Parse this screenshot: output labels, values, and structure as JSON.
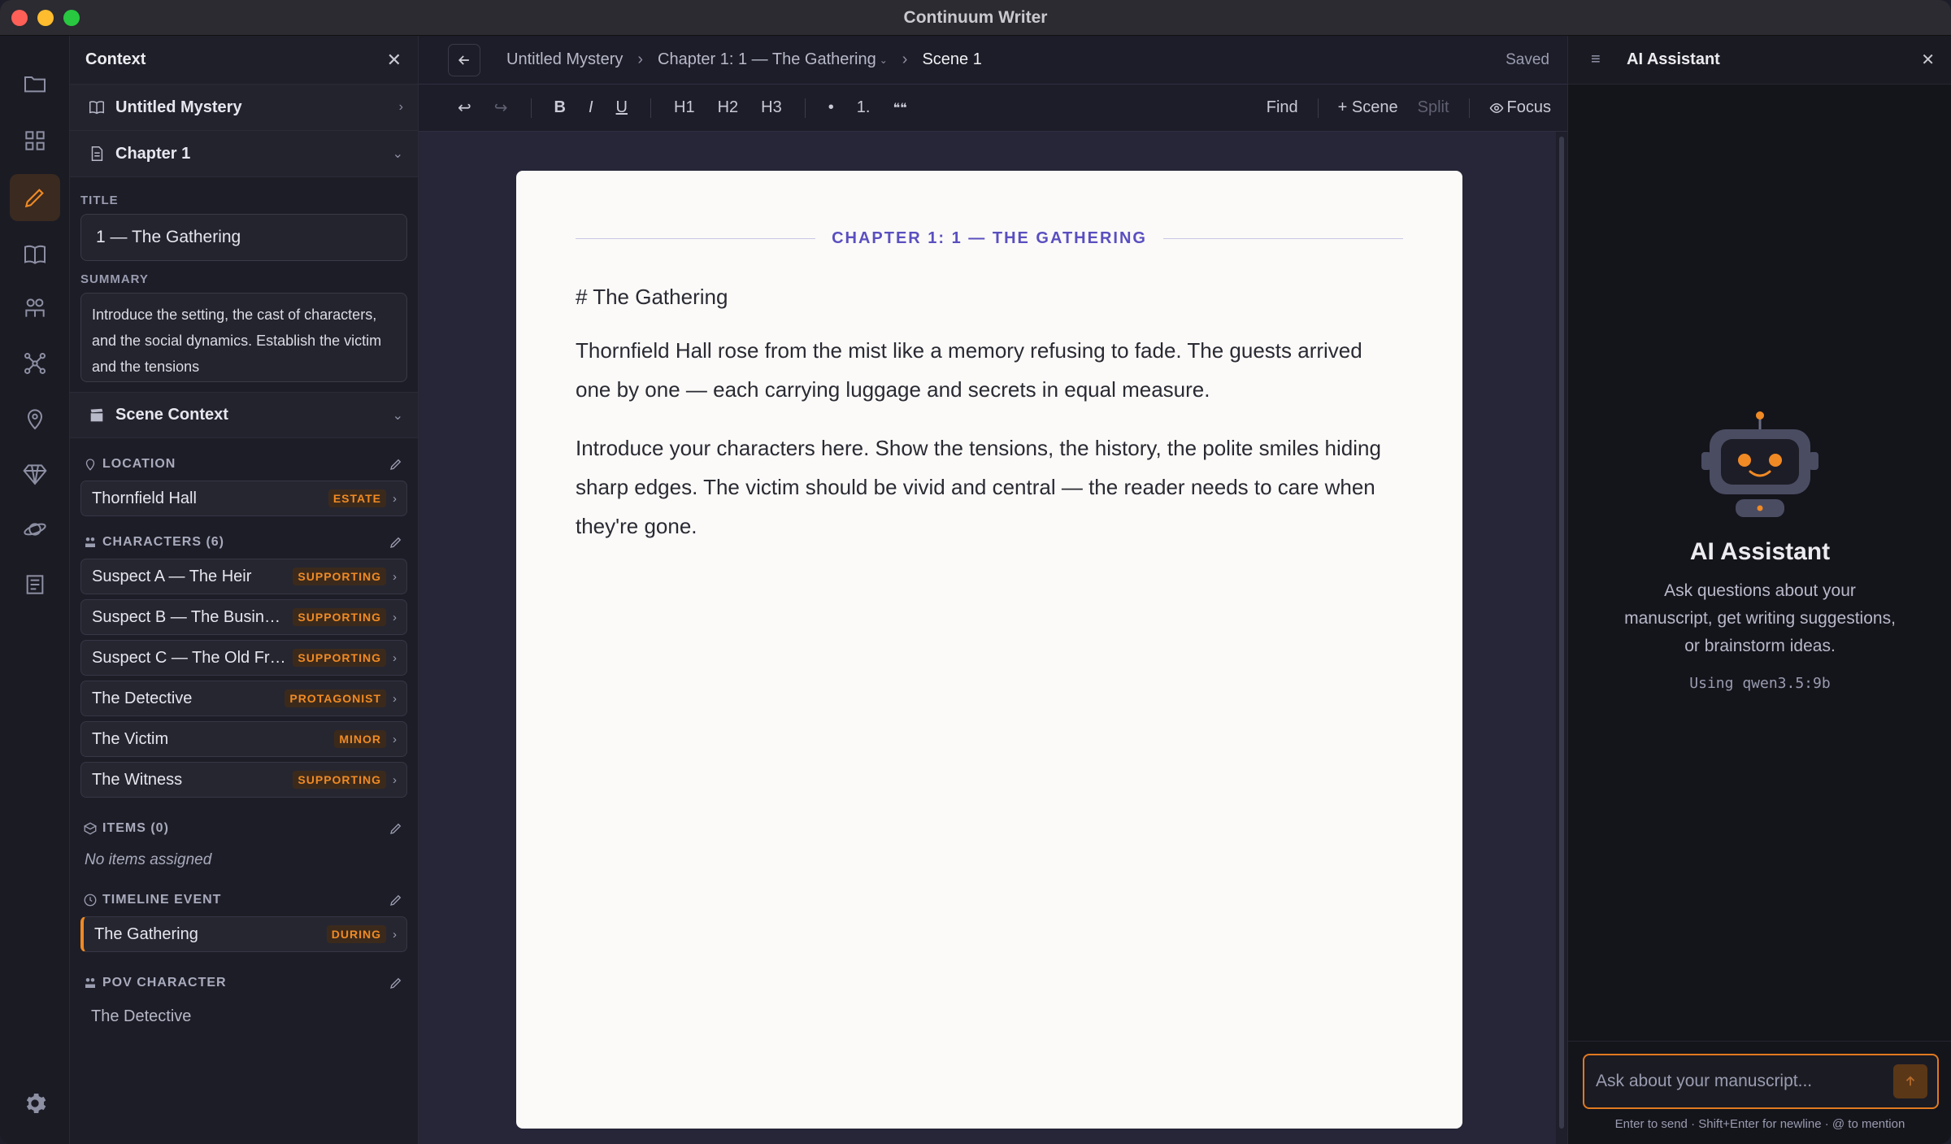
{
  "window": {
    "title": "Continuum Writer"
  },
  "rail": {
    "items": [
      {
        "icon": "folder-icon"
      },
      {
        "icon": "grid-icon"
      },
      {
        "icon": "pencil-icon",
        "active": true
      },
      {
        "icon": "book-icon"
      },
      {
        "icon": "characters-icon"
      },
      {
        "icon": "graph-icon"
      },
      {
        "icon": "location-pin-icon"
      },
      {
        "icon": "gem-icon"
      },
      {
        "icon": "planet-icon"
      },
      {
        "icon": "notes-icon"
      }
    ],
    "settings_icon": "gear-icon"
  },
  "context": {
    "header": "Context",
    "project": "Untitled Mystery",
    "chapter": "Chapter 1",
    "title_label": "TITLE",
    "title_value": "1 — The Gathering",
    "summary_label": "SUMMARY",
    "summary_value": "Introduce the setting, the cast of characters, and the social dynamics. Establish the victim and the tensions",
    "scene_context": "Scene Context",
    "location_label": "LOCATION",
    "location": {
      "name": "Thornfield Hall",
      "badge": "ESTATE"
    },
    "characters_label": "CHARACTERS (6)",
    "characters": [
      {
        "name": "Suspect A — The Heir",
        "badge": "SUPPORTING"
      },
      {
        "name": "Suspect B — The Businessman",
        "badge": "SUPPORTING"
      },
      {
        "name": "Suspect C — The Old Friend",
        "badge": "SUPPORTING"
      },
      {
        "name": "The Detective",
        "badge": "PROTAGONIST"
      },
      {
        "name": "The Victim",
        "badge": "MINOR"
      },
      {
        "name": "The Witness",
        "badge": "SUPPORTING"
      }
    ],
    "items_label": "ITEMS (0)",
    "items_empty": "No items assigned",
    "timeline_label": "TIMELINE EVENT",
    "timeline": {
      "name": "The Gathering",
      "badge": "DURING"
    },
    "pov_label": "POV CHARACTER",
    "pov_value": "The Detective"
  },
  "editor": {
    "breadcrumbs": [
      "Untitled Mystery",
      "Chapter 1: 1 — The Gathering",
      "Scene 1"
    ],
    "status": "Saved",
    "toolbar": {
      "undo": "↩",
      "redo": "↪",
      "bold": "B",
      "italic": "I",
      "underline": "U",
      "h1": "H1",
      "h2": "H2",
      "h3": "H3",
      "bullet": "•",
      "numbered": "1.",
      "quote": "❝❝",
      "find": "Find",
      "add_scene": "+ Scene",
      "split": "Split",
      "focus": "Focus"
    },
    "chapter_heading": "CHAPTER 1: 1 — THE GATHERING",
    "doc_heading": "# The Gathering",
    "paragraphs": [
      "Thornfield Hall rose from the mist like a memory refusing to fade. The guests arrived one by one — each carrying luggage and secrets in equal measure.",
      "Introduce your characters here. Show the tensions, the history, the polite smiles hiding sharp edges. The victim should be vivid and central — the reader needs to care when they're gone."
    ]
  },
  "ai": {
    "header": "AI Assistant",
    "empty_title": "AI Assistant",
    "empty_desc": "Ask questions about your manuscript, get writing suggestions, or brainstorm ideas.",
    "model": "Using qwen3.5:9b",
    "input_placeholder": "Ask about your manuscript...",
    "hint": "Enter to send · Shift+Enter for newline · @ to mention"
  },
  "colors": {
    "accent": "#f08a24",
    "chapter_heading": "#5a4fc0",
    "page": "#fbfaf8"
  }
}
